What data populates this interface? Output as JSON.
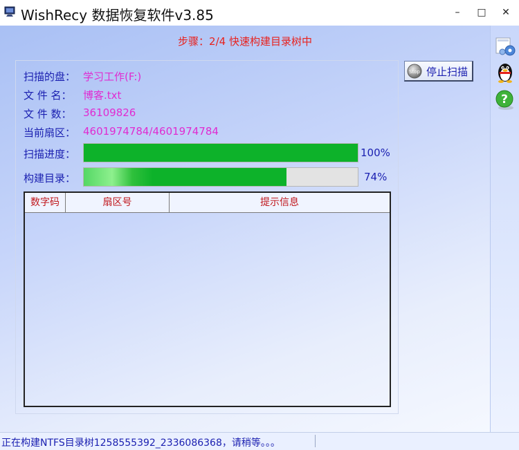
{
  "window": {
    "title": "WishRecy 数据恢复软件v3.85",
    "minimize_glyph": "–",
    "maximize_glyph": "□",
    "close_glyph": "✕"
  },
  "step": "步骤：2/4 快速构建目录树中",
  "info": {
    "disk_label": "扫描的盘：",
    "disk_value": "学习工作(F:)",
    "file_label": "文 件 名：",
    "file_value": "博客.txt",
    "count_label": "文 件 数：",
    "count_value": "36109826",
    "sector_label": "当前扇区：",
    "sector_value": "4601974784/4601974784"
  },
  "progress": {
    "scan_label": "扫描进度：",
    "scan_pct_text": "100%",
    "scan_value": 1.0,
    "build_label": "构建目录：",
    "build_pct_text": "74%",
    "build_value": 0.74
  },
  "stop_button": {
    "label": "停止扫描",
    "icon_text": "Stop"
  },
  "table": {
    "columns": [
      "数字码",
      "扇区号",
      "提示信息"
    ],
    "rows": []
  },
  "status": "正在构建NTFS目录树1258555392_2336086368，请稍等。。。",
  "colors": {
    "accent_text": "#1a1fb0",
    "value_text": "#e02bd1",
    "step_text": "#e8211d",
    "progress_green": "#0db22a",
    "header_text": "#c0171c"
  },
  "side_icons": [
    "settings-disk-icon",
    "qq-penguin-icon",
    "help-icon"
  ]
}
